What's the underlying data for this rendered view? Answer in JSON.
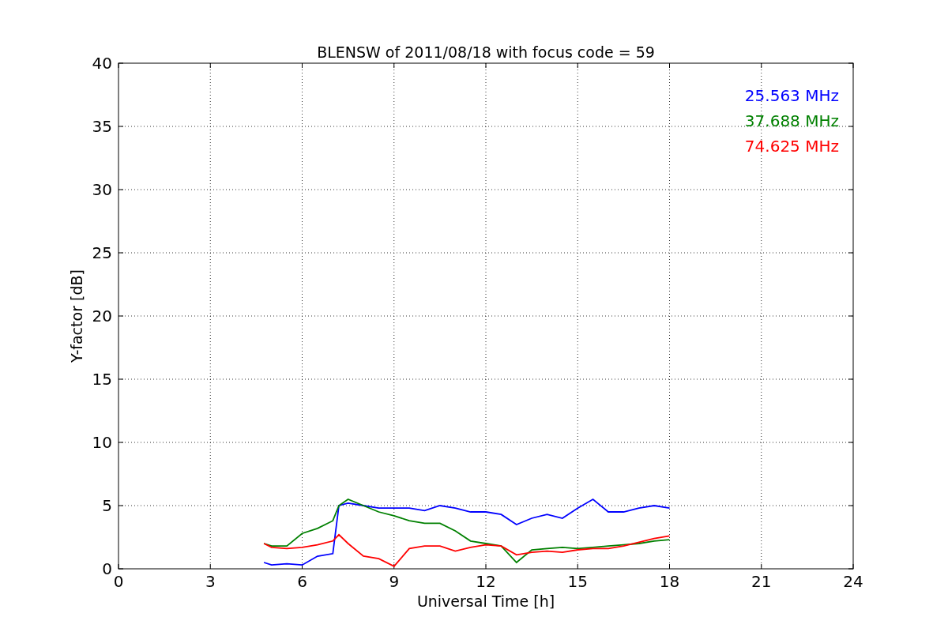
{
  "chart_data": {
    "type": "line",
    "title": "BLENSW of 2011/08/18 with focus code = 59",
    "xlabel": "Universal Time [h]",
    "ylabel": "Y-factor [dB]",
    "x": [
      4.75,
      5,
      5.5,
      6,
      6.5,
      7,
      7.2,
      7.5,
      8,
      8.5,
      9,
      9.5,
      10,
      10.5,
      11,
      11.5,
      12,
      12.5,
      13,
      13.5,
      14,
      14.5,
      15,
      15.5,
      16,
      16.5,
      17,
      17.5,
      18
    ],
    "series": [
      {
        "name": "25.563 MHz",
        "color": "#0000ff",
        "values": [
          0.5,
          0.3,
          0.4,
          0.3,
          1.0,
          1.2,
          5.0,
          5.2,
          5.0,
          4.8,
          4.8,
          4.8,
          4.6,
          5.0,
          4.8,
          4.5,
          4.5,
          4.3,
          3.5,
          4.0,
          4.3,
          4.0,
          4.8,
          5.5,
          4.5,
          4.5,
          4.8,
          5.0,
          4.8
        ]
      },
      {
        "name": "37.688 MHz",
        "color": "#008000",
        "values": [
          2.0,
          1.8,
          1.8,
          2.8,
          3.2,
          3.8,
          5.0,
          5.5,
          5.0,
          4.5,
          4.2,
          3.8,
          3.6,
          3.6,
          3.0,
          2.2,
          2.0,
          1.8,
          0.5,
          1.5,
          1.6,
          1.7,
          1.6,
          1.7,
          1.8,
          1.9,
          2.0,
          2.2,
          2.3
        ]
      },
      {
        "name": "74.625 MHz",
        "color": "#ff0000",
        "values": [
          2.0,
          1.7,
          1.6,
          1.7,
          1.9,
          2.2,
          2.7,
          2.0,
          1.0,
          0.8,
          0.2,
          1.6,
          1.8,
          1.8,
          1.4,
          1.7,
          1.9,
          1.8,
          1.1,
          1.3,
          1.4,
          1.3,
          1.5,
          1.6,
          1.6,
          1.8,
          2.1,
          2.4,
          2.6
        ]
      }
    ],
    "xlim": [
      0,
      24
    ],
    "ylim": [
      0,
      40
    ],
    "xticks": [
      0,
      3,
      6,
      9,
      12,
      15,
      18,
      21,
      24
    ],
    "yticks": [
      0,
      5,
      10,
      15,
      20,
      25,
      30,
      35,
      40
    ],
    "grid": true
  }
}
